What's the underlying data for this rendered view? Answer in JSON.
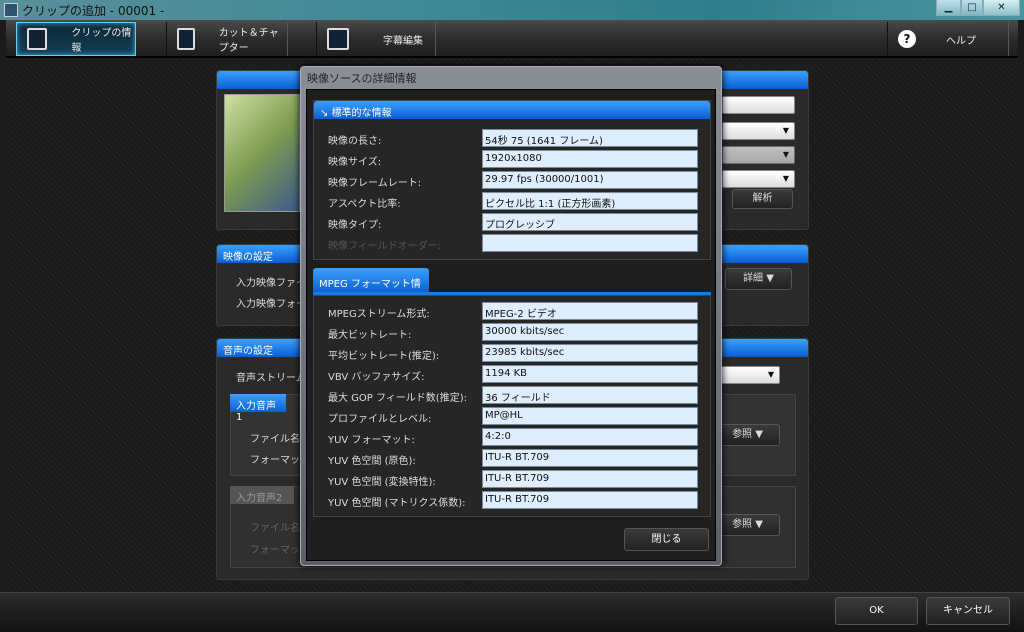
{
  "window": {
    "title": "クリップの追加 - 00001 -",
    "minimize": "▁",
    "maximize": "□",
    "close": "✕"
  },
  "toolbar": {
    "tabs": [
      {
        "label": "クリップの情報"
      },
      {
        "label": "カット＆チャプター"
      },
      {
        "label": "字幕編集"
      }
    ],
    "help": "ヘルプ"
  },
  "background": {
    "analyze_button": "解析",
    "video_settings": {
      "title": "映像の設定",
      "rows": [
        "入力映像ファイ",
        "入力映像フォー"
      ],
      "detail_button": "詳細"
    },
    "audio_settings": {
      "title": "音声の設定",
      "stream_label": "音声ストリーム",
      "input1": {
        "title": "入力音声1",
        "file": "ファイル名:",
        "format": "フォーマット:",
        "browse": "参照"
      },
      "input2": {
        "title": "入力音声2",
        "file": "ファイル名",
        "format": "フォーマット",
        "browse": "参照"
      }
    }
  },
  "dialog": {
    "title": "映像ソースの詳細情報",
    "standard": {
      "title": "標準的な情報",
      "rows": [
        {
          "k": "映像の長さ:",
          "v": "54秒 75 (1641 フレーム)"
        },
        {
          "k": "映像サイズ:",
          "v": "1920x1080"
        },
        {
          "k": "映像フレームレート:",
          "v": "29.97 fps (30000/1001)"
        },
        {
          "k": "アスペクト比率:",
          "v": "ピクセル比 1:1 (正方形画素)"
        },
        {
          "k": "映像タイプ:",
          "v": "プログレッシブ"
        },
        {
          "k": "映像フィールドオーダー:",
          "v": "",
          "disabled": true
        }
      ]
    },
    "mpeg": {
      "title": "MPEG フォーマット情報",
      "rows": [
        {
          "k": "MPEGストリーム形式:",
          "v": "MPEG-2 ビデオ"
        },
        {
          "k": "最大ビットレート:",
          "v": "30000 kbits/sec"
        },
        {
          "k": "平均ビットレート(推定):",
          "v": "23985 kbits/sec"
        },
        {
          "k": "VBV バッファサイズ:",
          "v": "1194 KB"
        },
        {
          "k": "最大 GOP フィールド数(推定):",
          "v": "36 フィールド"
        },
        {
          "k": "プロファイルとレベル:",
          "v": "MP@HL"
        },
        {
          "k": "YUV フォーマット:",
          "v": "4:2:0"
        },
        {
          "k": "YUV 色空間 (原色):",
          "v": "ITU-R BT.709"
        },
        {
          "k": "YUV 色空間 (変換特性):",
          "v": "ITU-R BT.709"
        },
        {
          "k": "YUV 色空間 (マトリクス係数):",
          "v": "ITU-R BT.709"
        }
      ]
    },
    "close": "閉じる"
  },
  "footer": {
    "ok": "OK",
    "cancel": "キャンセル"
  }
}
